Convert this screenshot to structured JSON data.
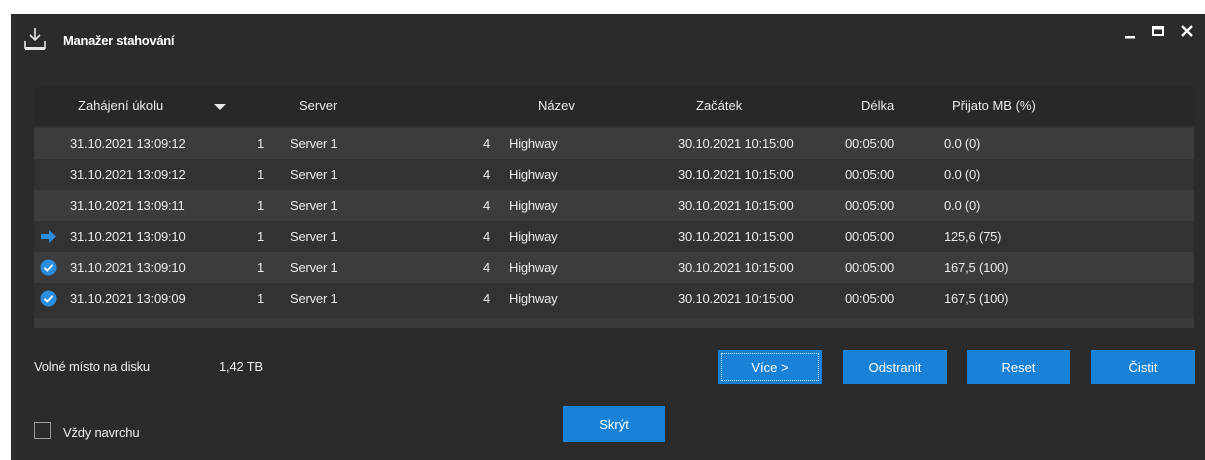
{
  "window": {
    "title": "Manažer stahování"
  },
  "table": {
    "headers": {
      "start": "Zahájení úkolu",
      "server": "Server",
      "name": "Název",
      "begin": "Začátek",
      "length": "Délka",
      "received": "Přijato MB (%)"
    },
    "rows": [
      {
        "status_icon": "",
        "start": "31.10.2021 13:09:12",
        "server_num": "1",
        "server": "Server 1",
        "name_num": "4",
        "name": "Highway",
        "begin": "30.10.2021 10:15:00",
        "length": "00:05:00",
        "received": "0.0 (0)"
      },
      {
        "status_icon": "",
        "start": "31.10.2021 13:09:12",
        "server_num": "1",
        "server": "Server 1",
        "name_num": "4",
        "name": "Highway",
        "begin": "30.10.2021 10:15:00",
        "length": "00:05:00",
        "received": "0.0 (0)"
      },
      {
        "status_icon": "",
        "start": "31.10.2021 13:09:11",
        "server_num": "1",
        "server": "Server 1",
        "name_num": "4",
        "name": "Highway",
        "begin": "30.10.2021 10:15:00",
        "length": "00:05:00",
        "received": "0.0 (0)"
      },
      {
        "status_icon": "arrow-right-icon",
        "start": "31.10.2021 13:09:10",
        "server_num": "1",
        "server": "Server 1",
        "name_num": "4",
        "name": "Highway",
        "begin": "30.10.2021 10:15:00",
        "length": "00:05:00",
        "received": "125,6 (75)"
      },
      {
        "status_icon": "check-circle-icon",
        "start": "31.10.2021 13:09:10",
        "server_num": "1",
        "server": "Server 1",
        "name_num": "4",
        "name": "Highway",
        "begin": "30.10.2021 10:15:00",
        "length": "00:05:00",
        "received": "167,5 (100)"
      },
      {
        "status_icon": "check-circle-icon",
        "start": "31.10.2021 13:09:09",
        "server_num": "1",
        "server": "Server 1",
        "name_num": "4",
        "name": "Highway",
        "begin": "30.10.2021 10:15:00",
        "length": "00:05:00",
        "received": "167,5 (100)"
      }
    ]
  },
  "footer": {
    "disk_label": "Volné místo na disku",
    "disk_value": "1,42 TB",
    "more_button": "Více >",
    "remove_button": "Odstranit",
    "reset_button": "Reset",
    "clear_button": "Čistit",
    "hide_button": "Skrýt",
    "always_on_top_label": "Vždy navrchu"
  },
  "colors": {
    "background": "#2b2b2b",
    "accent": "#1a82d6",
    "row_odd": "#3c3c3c",
    "row_even": "#323232",
    "icon_blue": "#2a8ee0"
  }
}
